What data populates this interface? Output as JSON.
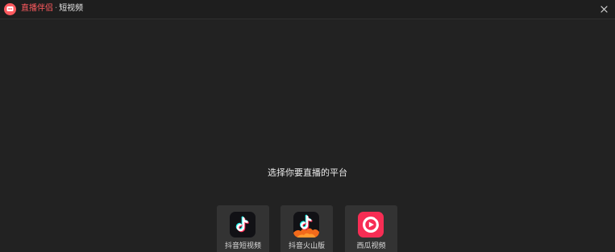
{
  "titlebar": {
    "app_name": "直播伴侣",
    "separator": "·",
    "section": "短视频",
    "close_glyph": "✕",
    "brand_color": "#ff5a5f",
    "logo_icon": "app-logo-icon",
    "close_icon": "close-icon"
  },
  "main": {
    "prompt": "选择你要直播的平台",
    "platforms": [
      {
        "label": "抖音短视频",
        "icon": "douyin-icon"
      },
      {
        "label": "抖音火山版",
        "icon": "douyin-huoshan-icon"
      },
      {
        "label": "西瓜视频",
        "icon": "xigua-video-icon"
      }
    ]
  }
}
